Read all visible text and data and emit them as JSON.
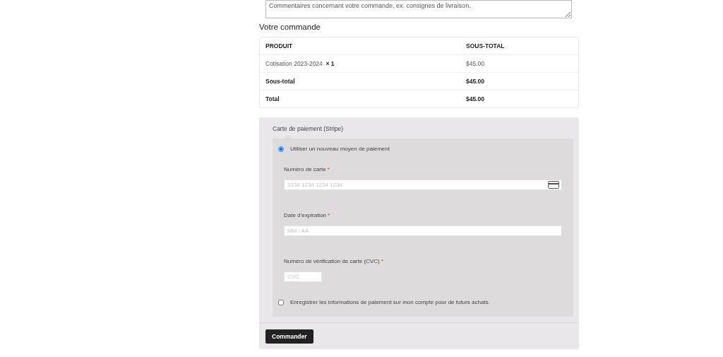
{
  "notes_field": {
    "value": "Commentaires concernant votre commande, ex. consignes de livraison."
  },
  "order": {
    "title": "Votre commande",
    "columns": [
      "PRODUIT",
      "SOUS-TOTAL"
    ],
    "rows": [
      {
        "kind": "item",
        "label": "Cotisation 2023-2024",
        "quantity": "× 1",
        "amount": "$45.00"
      },
      {
        "kind": "summary",
        "label": "Sous-total",
        "amount": "$45.00"
      },
      {
        "kind": "summary",
        "label": "Total",
        "amount": "$45.00"
      }
    ]
  },
  "payment": {
    "method_label": "Carte de paiement (Stripe)",
    "new_method": {
      "label": "Utiliser un nouveau moyen de paiement",
      "selected": true
    },
    "fields": [
      {
        "kind": "card",
        "label": "Numéro de carte",
        "required_mark": "*",
        "placeholder": "1234 1234 1234 1234"
      },
      {
        "kind": "wide",
        "label": "Date d’expiration",
        "required_mark": "*",
        "placeholder": "MM / AA"
      },
      {
        "kind": "short",
        "label": "Numéro de vérification de carte (CVC)",
        "required_mark": "*",
        "placeholder": "CVC"
      }
    ],
    "save_info": {
      "label": "Enregistrer les informations de paiement sur mon compte pour de futurs achats.",
      "checked": false
    }
  },
  "submit_button": "Commander"
}
